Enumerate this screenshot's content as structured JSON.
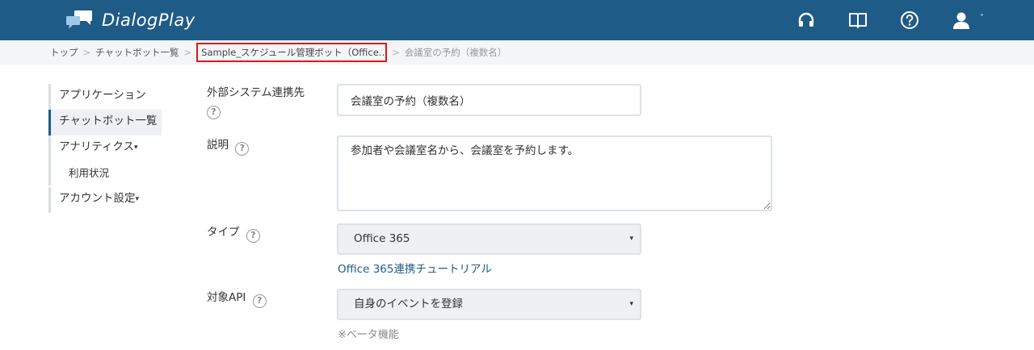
{
  "header": {
    "app_name": "DialogPlay",
    "brand_color": "#1f5b87",
    "icons": [
      "headset-icon",
      "book-icon",
      "help-icon",
      "user-icon"
    ],
    "user_menu_caret": "˅"
  },
  "breadcrumb": {
    "items": [
      "トップ",
      "チャットボット一覧",
      "Sample_スケジュール管理ボット（Office…"
    ],
    "current": "会議室の予約（複数名）",
    "separator": ">"
  },
  "sidebar": {
    "items": [
      {
        "label": "アプリケーション"
      },
      {
        "label": "チャットボット一覧"
      },
      {
        "label": "アナリティクス"
      },
      {
        "label": "利用状況"
      },
      {
        "label": "アカウント設定"
      }
    ],
    "caret": "▾"
  },
  "form": {
    "external_system": {
      "label": "外部システム連携先",
      "value": "会議室の予約（複数名）"
    },
    "description": {
      "label": "説明",
      "value": "参加者や会議室名から、会議室を予約します。"
    },
    "type": {
      "label": "タイプ",
      "value": "Office 365",
      "tutorial_link": "Office 365連携チュートリアル"
    },
    "target_api": {
      "label": "対象API",
      "value": "自身のイベントを登録",
      "note": "※ベータ機能"
    },
    "help_glyph": "?",
    "select_arrow": "▾"
  }
}
